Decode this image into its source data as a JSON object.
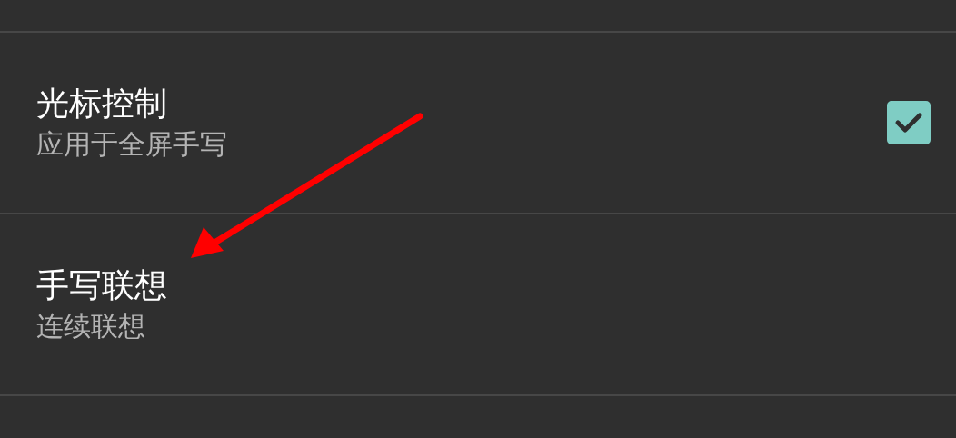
{
  "settings": [
    {
      "kind": "checkbox",
      "title": "光标控制",
      "summary": "应用于全屏手写",
      "checked": true
    },
    {
      "kind": "plain",
      "title": "手写联想",
      "summary": "连续联想"
    }
  ]
}
